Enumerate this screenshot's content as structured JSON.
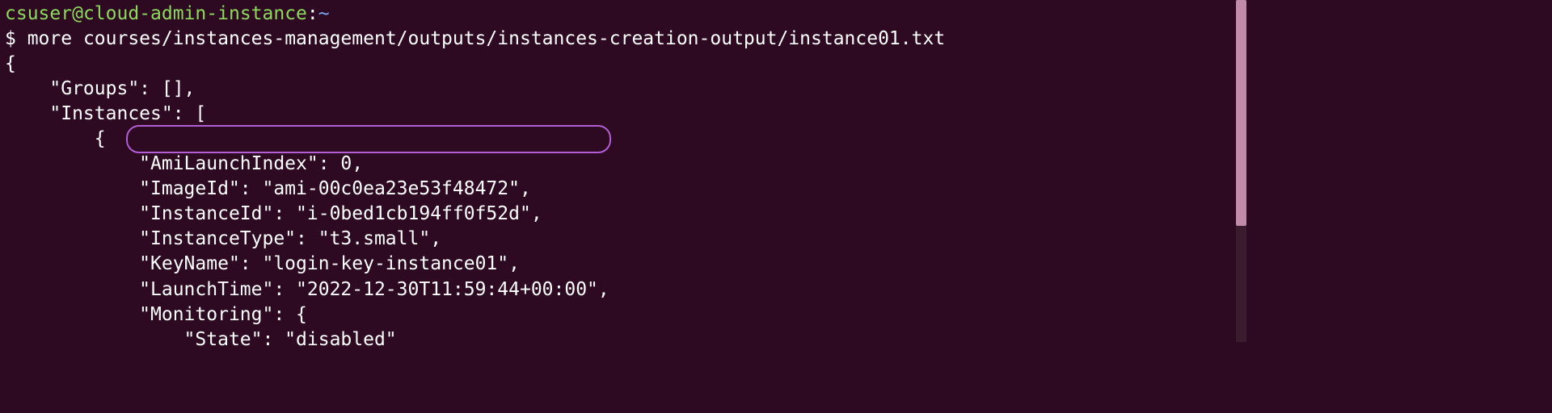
{
  "prompt": {
    "user": "csuser",
    "at": "@",
    "host": "cloud-admin-instance",
    "colon": ":",
    "cwd": "~"
  },
  "command": {
    "dollar": "$ ",
    "text": "more courses/instances-management/outputs/instances-creation-output/instance01.txt"
  },
  "output": {
    "l1": "{",
    "l2": "    \"Groups\": [],",
    "l3": "    \"Instances\": [",
    "l4": "        {",
    "l5": "            \"AmiLaunchIndex\": 0,",
    "l6": "            \"ImageId\": \"ami-00c0ea23e53f48472\",",
    "l7": "            \"InstanceId\": \"i-0bed1cb194ff0f52d\",",
    "l8": "            \"InstanceType\": \"t3.small\",",
    "l9": "            \"KeyName\": \"login-key-instance01\",",
    "l10": "            \"LaunchTime\": \"2022-12-30T11:59:44+00:00\",",
    "l11": "            \"Monitoring\": {",
    "l12": "                \"State\": \"disabled\""
  }
}
